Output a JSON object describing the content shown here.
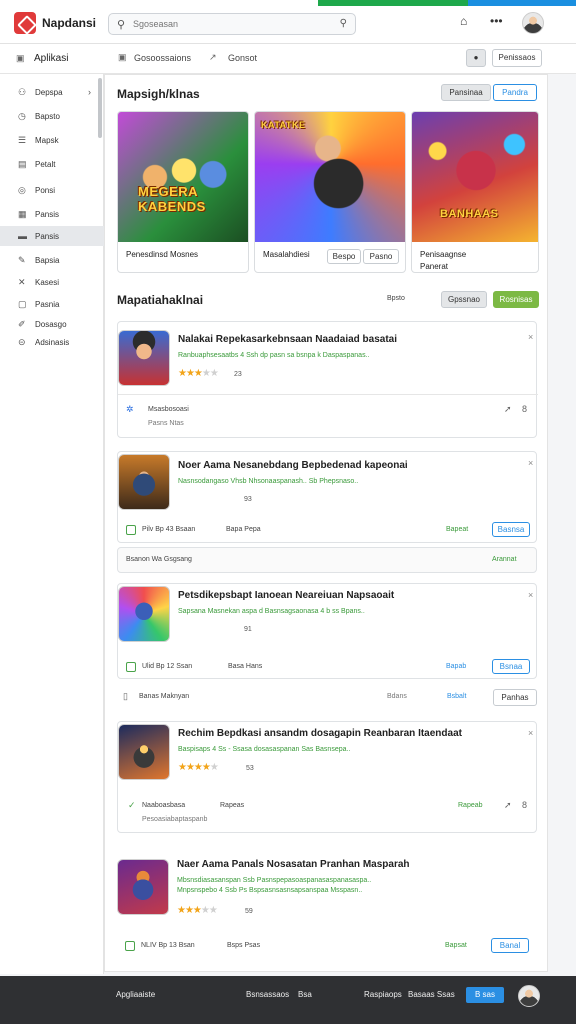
{
  "header": {
    "app_name": "Napdansi",
    "search_placeholder": "Sgoseasan"
  },
  "subbar": {
    "section": "Aplikasi",
    "crumb1": "Gosoossaions",
    "crumb2": "Gonsot",
    "btn_primary": "Penissaos"
  },
  "sidebar": {
    "items": [
      {
        "icon": "user-icon",
        "label": "Depspa"
      },
      {
        "icon": "clock-icon",
        "label": "Bapsto"
      },
      {
        "icon": "list-icon",
        "label": "Mapsk"
      },
      {
        "icon": "doc-icon",
        "label": "Petalt"
      },
      {
        "icon": "star-icon",
        "label": "Ponsi"
      },
      {
        "icon": "chart-icon",
        "label": "Pansis"
      },
      {
        "icon": "tag-icon",
        "label": "Pansis"
      },
      {
        "icon": "pin-icon",
        "label": "Bapsia"
      },
      {
        "icon": "gear-icon",
        "label": "Kasesi"
      },
      {
        "icon": "info-icon",
        "label": "Pasnia"
      },
      {
        "icon": "edit-icon",
        "label": "Dosasgo"
      },
      {
        "icon": "help-icon",
        "label": "Adsinasis"
      }
    ]
  },
  "featured": {
    "title": "Mapsigh/klnas",
    "btn1": "Pansinaa",
    "btn2": "Pandra",
    "cards": [
      {
        "img_text": "MEGERA KABENDS",
        "caption": "Penesdinsd Mosnes"
      },
      {
        "img_text": "KATATKE",
        "caption": "Masalahdiesi",
        "chip1": "Bespo",
        "chip2": "Pasno"
      },
      {
        "img_text": "BANHAAS",
        "caption": "Penisaagnse",
        "caption2": "Panerat"
      }
    ]
  },
  "reviews": {
    "title": "Mapatiahaklnai",
    "filter_label": "Bpsto",
    "btn_gray": "Gpssnao",
    "btn_green": "Rosnisas",
    "items": [
      {
        "title": "Nalakai Repekasarkebnsaan Naadaiad basatai",
        "sub": "Ranbuaphsesaatbs 4 Ssh dp pasn sa bsnpa k Daspaspanas..",
        "count": "23",
        "rating": 3.5,
        "foot1": "Msasbosoasi",
        "foot2": "Pasns Ntas"
      },
      {
        "title": "Noer Aama Nesanebdang Bepbedenad kapeonai",
        "sub": "Nasnsodangaso   Vhsb   Nhsonaaspanash..  Sb   Phepsnaso..",
        "count": "93",
        "rating": 0,
        "foot1": "Pilv Bp 43 Bsaan",
        "foot2": "Bapa Pepa",
        "foot_btn": "Basnsa",
        "foot_link": "Bapeat",
        "row2_left": "Bsanon Wa Gsgsang",
        "row2_right": "Arannat"
      },
      {
        "title": "Petsdikepsbapt Ianoean Neareiuan Napsaoait",
        "sub": "Sapsana Masnekan aspa d Basnsagsaonasa 4 b ss Bpans..",
        "count": "91",
        "rating": 0,
        "foot1": "Ulid Bp 12 Ssan",
        "foot2": "Basa Hans",
        "foot_btn": "Bsnaa",
        "foot_link": "Bapab",
        "row2_left": "Banas Maknyan",
        "row2_mid": "Bdans",
        "row2_link": "Bsbalt",
        "row2_btn": "Panhas"
      },
      {
        "title": "Rechim Bepdkasi ansandm dosagapin Reanbaran Itaendaat",
        "sub": "Baspisaps 4 Ss - Ssasa dosasaspanan Sas Basnsepa..",
        "count": "53",
        "rating": 4,
        "foot1": "Naaboasbasa",
        "foot2": "Rapeas",
        "foot_link": "Rapeab",
        "foot_sub": "Pesoasiabaptaspanb"
      },
      {
        "title": "Naer Aama Panals Nosasatan Pranhan Masparah",
        "sub": "Mbsnsdiasasanspan  Ssb  Pasnspepasoaspanasaspanasaspa..",
        "sub2": "Mnpsnspebo 4 Ssb Ps Bspsasnsasnsapsanspaa Msspasn..",
        "count": "59",
        "rating": 3.5,
        "foot1": "NLIV Bp 13 Bsan",
        "foot2": "Bsps Psas",
        "foot_btn": "Banal",
        "foot_link": "Bapsat"
      }
    ]
  },
  "footer": {
    "left": "Apgliaaiste",
    "mid1": "Bsnsassaos",
    "mid2": "Bsa",
    "right1": "Raspiaops",
    "right2": "Basaas Ssas",
    "btn": "B sas"
  }
}
